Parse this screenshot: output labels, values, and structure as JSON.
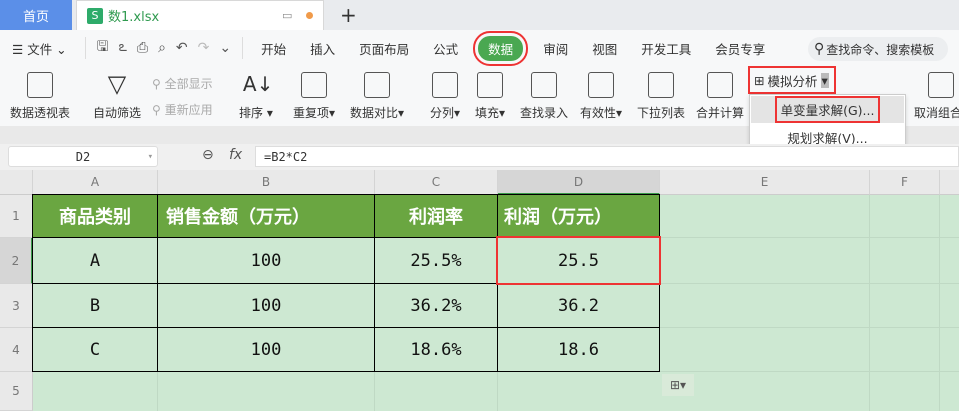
{
  "tabs": {
    "home": "首页",
    "file": "数1.xlsx"
  },
  "menu": {
    "file": "文件",
    "items": [
      "开始",
      "插入",
      "页面布局",
      "公式",
      "数据",
      "审阅",
      "视图",
      "开发工具",
      "会员专享"
    ],
    "search_placeholder": "查找命令、搜索模板"
  },
  "ribbon": {
    "pivot": "数据透视表",
    "autofilter": "自动筛选",
    "show_all": "全部显示",
    "reapply": "重新应用",
    "sort": "排序",
    "duplicates": "重复项",
    "compare": "数据对比",
    "split": "分列",
    "fill": "填充",
    "lookup": "查找录入",
    "validity": "有效性",
    "dropdown_list": "下拉列表",
    "consolidate": "合并计算",
    "whatif": "模拟分析",
    "ungroup": "取消组合"
  },
  "whatif_menu": [
    "单变量求解(G)...",
    "规划求解(V)..."
  ],
  "formula_bar": {
    "name_box": "D2",
    "fx": "fx",
    "formula": "=B2*C2"
  },
  "columns": [
    "A",
    "B",
    "C",
    "D",
    "E",
    "F"
  ],
  "rows": [
    "1",
    "2",
    "3",
    "4",
    "5"
  ],
  "table": {
    "headers": [
      "商品类别",
      "销售金额（万元）",
      "利润率",
      "利润（万元）"
    ],
    "data": [
      [
        "A",
        "100",
        "25.5%",
        "25.5"
      ],
      [
        "B",
        "100",
        "36.2%",
        "36.2"
      ],
      [
        "C",
        "100",
        "18.6%",
        "18.6"
      ]
    ]
  }
}
